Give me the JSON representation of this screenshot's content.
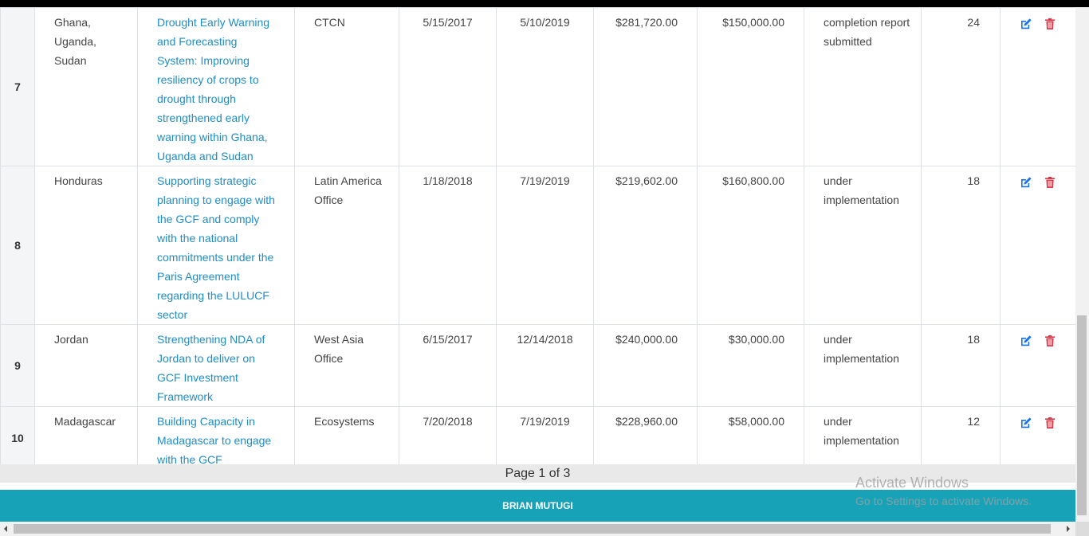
{
  "table": {
    "rows": [
      {
        "index": "7",
        "country": "Ghana, Uganda, Sudan",
        "project": "Drought Early Warning and Forecasting System: Improving resiliency of crops to drought through strengthened early warning within Ghana, Uganda and Sudan",
        "office": "CTCN",
        "start_date": "5/15/2017",
        "end_date": "5/10/2019",
        "budget": "$281,720.00",
        "amount": "$150,000.00",
        "status": "completion report submitted",
        "months": "24"
      },
      {
        "index": "8",
        "country": "Honduras",
        "project": "Supporting strategic planning to engage with the GCF and comply with the national commitments under the Paris Agreement regarding the LULUCF sector",
        "office": "Latin America Office",
        "start_date": "1/18/2018",
        "end_date": "7/19/2019",
        "budget": "$219,602.00",
        "amount": "$160,800.00",
        "status": "under implementation",
        "months": "18"
      },
      {
        "index": "9",
        "country": "Jordan",
        "project": "Strengthening NDA of Jordan to deliver on GCF Investment Framework",
        "office": "West Asia Office",
        "start_date": "6/15/2017",
        "end_date": "12/14/2018",
        "budget": "$240,000.00",
        "amount": "$30,000.00",
        "status": "under implementation",
        "months": "18"
      },
      {
        "index": "10",
        "country": "Madagascar",
        "project": "Building Capacity in Madagascar to engage with the GCF",
        "office": "Ecosystems",
        "start_date": "7/20/2018",
        "end_date": "7/19/2019",
        "budget": "$228,960.00",
        "amount": "$58,000.00",
        "status": "under implementation",
        "months": "12"
      }
    ]
  },
  "pager": {
    "text": "Page 1 of 3"
  },
  "footer": {
    "text": "BRIAN MUTUGI"
  },
  "watermark": {
    "title": "Activate Windows",
    "subtitle": "Go to Settings to activate Windows."
  },
  "icons": {
    "edit": "edit-icon",
    "delete": "trash-icon"
  },
  "colors": {
    "link": "#1f8dc6",
    "edit": "#1a73e8",
    "delete": "#dc3545",
    "footer": "#17a2b8"
  }
}
